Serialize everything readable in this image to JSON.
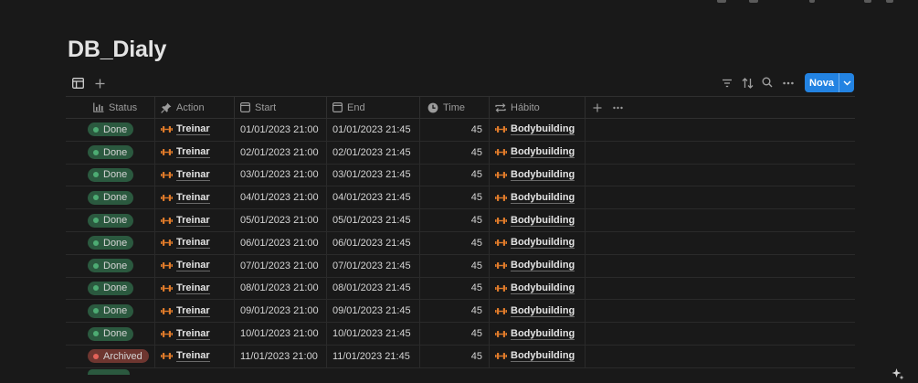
{
  "page": {
    "title": "DB_Dialy"
  },
  "toolbar": {
    "new_label": "Nova"
  },
  "columns": {
    "status": "Status",
    "action": "Action",
    "start": "Start",
    "end": "End",
    "time": "Time",
    "habit": "Hábito"
  },
  "rows": [
    {
      "status": "Done",
      "action": "Treinar",
      "start": "01/01/2023 21:00",
      "end": "01/01/2023 21:45",
      "time": "45",
      "habit": "Bodybuilding"
    },
    {
      "status": "Done",
      "action": "Treinar",
      "start": "02/01/2023 21:00",
      "end": "02/01/2023 21:45",
      "time": "45",
      "habit": "Bodybuilding"
    },
    {
      "status": "Done",
      "action": "Treinar",
      "start": "03/01/2023 21:00",
      "end": "03/01/2023 21:45",
      "time": "45",
      "habit": "Bodybuilding"
    },
    {
      "status": "Done",
      "action": "Treinar",
      "start": "04/01/2023 21:00",
      "end": "04/01/2023 21:45",
      "time": "45",
      "habit": "Bodybuilding"
    },
    {
      "status": "Done",
      "action": "Treinar",
      "start": "05/01/2023 21:00",
      "end": "05/01/2023 21:45",
      "time": "45",
      "habit": "Bodybuilding"
    },
    {
      "status": "Done",
      "action": "Treinar",
      "start": "06/01/2023 21:00",
      "end": "06/01/2023 21:45",
      "time": "45",
      "habit": "Bodybuilding"
    },
    {
      "status": "Done",
      "action": "Treinar",
      "start": "07/01/2023 21:00",
      "end": "07/01/2023 21:45",
      "time": "45",
      "habit": "Bodybuilding"
    },
    {
      "status": "Done",
      "action": "Treinar",
      "start": "08/01/2023 21:00",
      "end": "08/01/2023 21:45",
      "time": "45",
      "habit": "Bodybuilding"
    },
    {
      "status": "Done",
      "action": "Treinar",
      "start": "09/01/2023 21:00",
      "end": "09/01/2023 21:45",
      "time": "45",
      "habit": "Bodybuilding"
    },
    {
      "status": "Done",
      "action": "Treinar",
      "start": "10/01/2023 21:00",
      "end": "10/01/2023 21:45",
      "time": "45",
      "habit": "Bodybuilding"
    },
    {
      "status": "Archived",
      "action": "Treinar",
      "start": "11/01/2023 21:00",
      "end": "11/01/2023 21:45",
      "time": "45",
      "habit": "Bodybuilding"
    }
  ],
  "colors": {
    "background": "#191919",
    "accent": "#2383e2",
    "done_bg": "#2b593f",
    "done_dot": "#4dab73",
    "archived_bg": "#6e3630",
    "archived_dot": "#e16259",
    "relation_icon": "#e07b2a"
  },
  "icons": {
    "view": "table-icon",
    "add_view": "plus-icon",
    "filter": "filter-icon",
    "sort": "sort-icon",
    "search": "search-icon",
    "more": "more-icon",
    "status_col": "bar-chart-icon",
    "action_col": "pin-icon",
    "date_col": "calendar-icon",
    "time_col": "clock-icon",
    "habit_col": "relation-arrows-icon",
    "relation_item": "dumbbell-icon",
    "assistant": "sparkle-icon"
  }
}
